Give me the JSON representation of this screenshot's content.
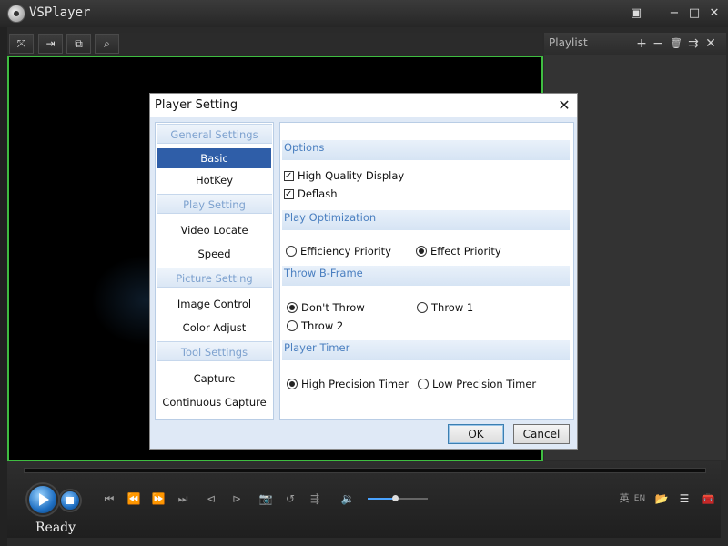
{
  "app": {
    "title": "VSPlayer"
  },
  "window_controls": {
    "menu": "▣",
    "minimize": "−",
    "maximize": "□",
    "close": "✕"
  },
  "video_toolbar": {
    "buttons": [
      "⤧",
      "⇥",
      "⧉",
      "⌕"
    ]
  },
  "playlist": {
    "title": "Playlist",
    "add": "+",
    "remove": "−",
    "delete": "🗑",
    "move": "⇉",
    "close": "✕"
  },
  "controls": {
    "prev": "⏮",
    "rewind": "⏪",
    "forward": "⏩",
    "next": "⏭",
    "frame_back": "⊲",
    "frame_forward": "⊳",
    "capture": "📷",
    "repeat": "↺",
    "adjust": "⇶",
    "volume": "🔉",
    "volume_level": 0.45,
    "lang": "英",
    "en": "EN",
    "folder": "📂",
    "list": "☰",
    "toolbox": "🧰",
    "status": "Ready"
  },
  "dialog": {
    "title": "Player Setting",
    "close": "✕",
    "sidebar": {
      "general": "General Settings",
      "basic": "Basic",
      "hotkey": "HotKey",
      "play": "Play Setting",
      "video_locate": "Video Locate",
      "speed": "Speed",
      "picture": "Picture Setting",
      "image_control": "Image Control",
      "color_adjust": "Color Adjust",
      "tool": "Tool Settings",
      "capture": "Capture",
      "continuous_capture": "Continuous Capture"
    },
    "options": {
      "header": "Options",
      "high_quality": "High Quality Display",
      "deflash": "Deflash"
    },
    "play_optimization": {
      "header": "Play Optimization",
      "efficiency": "Efficiency Priority",
      "effect": "Effect Priority"
    },
    "throw_bframe": {
      "header": "Throw B-Frame",
      "dont": "Don't Throw",
      "throw1": "Throw 1",
      "throw2": "Throw 2"
    },
    "player_timer": {
      "header": "Player Timer",
      "high": "High Precision Timer",
      "low": "Low Precision Timer"
    },
    "ok": "OK",
    "cancel": "Cancel"
  }
}
